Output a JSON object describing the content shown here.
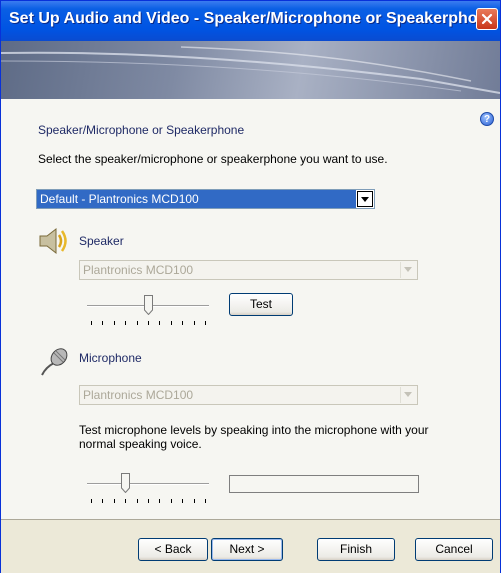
{
  "window": {
    "title": "Set Up Audio and Video - Speaker/Microphone or Speakerphone",
    "close_icon": "close-icon",
    "help_icon": "help-icon",
    "help_glyph": "?"
  },
  "page": {
    "heading": "Speaker/Microphone or Speakerphone",
    "instruction": "Select the speaker/microphone or speakerphone you want to use.",
    "device_select": {
      "value": "Default - Plantronics MCD100"
    }
  },
  "speaker": {
    "label": "Speaker",
    "icon": "speaker-icon",
    "device": "Plantronics MCD100",
    "volume_level": 0.5,
    "test_label": "Test"
  },
  "microphone": {
    "label": "Microphone",
    "icon": "microphone-icon",
    "device": "Plantronics MCD100",
    "instruction_line1": "Test microphone levels by speaking into the microphone with your",
    "instruction_line2": "normal speaking voice.",
    "volume_level": 0.3,
    "meter_level": 0
  },
  "footer": {
    "back_label": "< Back",
    "next_label": "Next >",
    "finish_label": "Finish",
    "cancel_label": "Cancel"
  },
  "colors": {
    "titlebar": "#0054e3",
    "selection": "#316ac5",
    "section_text": "#1f2a66",
    "disabled_text": "#aca899"
  }
}
